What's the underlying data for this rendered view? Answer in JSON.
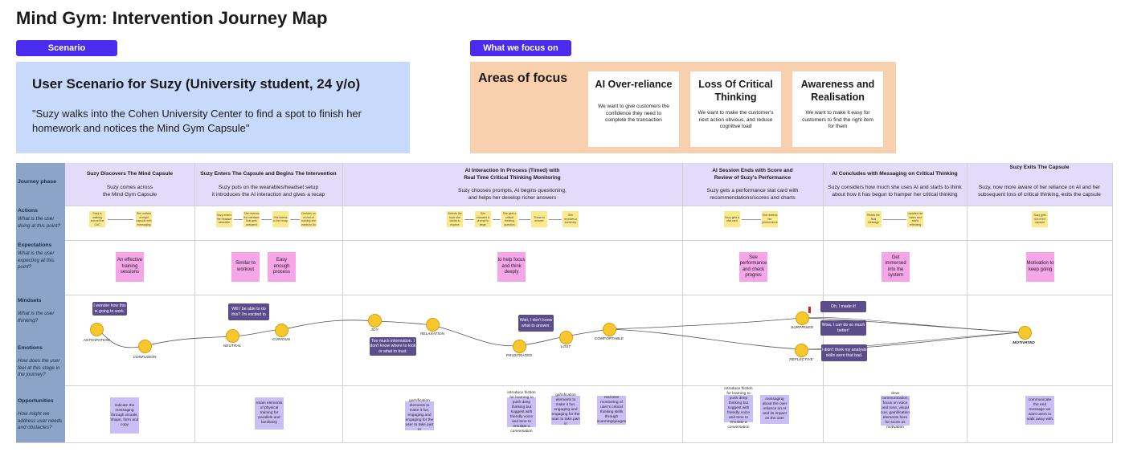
{
  "page_title": "Mind Gym: Intervention Journey Map",
  "scenario": {
    "tag": "Scenario",
    "title": "User Scenario for Suzy (University student, 24 y/o)",
    "quote": "\"Suzy walks into the Cohen University Center to find a spot to finish her homework and notices the Mind Gym Capsule\""
  },
  "focus": {
    "tag": "What we focus on",
    "heading": "Areas of focus",
    "cards": [
      {
        "title": "AI Over-reliance",
        "desc": "We want to give customers the confidence they need to complete the transaction"
      },
      {
        "title": "Loss Of Critical Thinking",
        "desc": "We want to make the customer's next action obvious, and reduce cognitive load"
      },
      {
        "title": "Awareness and Realisation",
        "desc": "We want to make it easy for customers to find the right item for them"
      }
    ]
  },
  "rows": {
    "journey": "Journey phase",
    "actions": "Actions",
    "actions_sub": "What is the user doing at this point?",
    "expectations": "Expectations",
    "expectations_sub": "What is the user expecting at this point?",
    "mindsets": "Mindsets",
    "mindsets_sub": "What is the user thinking?",
    "emotions": "Emotions",
    "emotions_sub": "How does the user feel at this stage in the journey?",
    "opportunities": "Opportunities",
    "opportunities_sub": "How might we address user needs and obstacles?"
  },
  "phases": [
    {
      "title": "Suzy Discovers The Mind Capsule",
      "desc": "Suzy comes across\nthe Mind Gym Capsule"
    },
    {
      "title": "Suzy Enters The Capsule and Begins The Intervention",
      "desc": "Suzy puts on the wearables/headset setup\nit introduces the AI interaction and gives a recap"
    },
    {
      "title": "AI Interaction In Process (Timed) with\nReal Time Critical Thinking Monitoring",
      "desc": "Suzy chooses prompts, AI begins questioning,\nand helps her develop richer answers"
    },
    {
      "title": "AI Session Ends with Score and\nReview of Suzy's Performance",
      "desc": "Suzy gets a performance stat card with\nrecommendations/scores and charts"
    },
    {
      "title": "AI Concludes with Messaging on Critical Thinking",
      "desc": "Suzy considers how much she uses AI and starts to think\nabout how it has begun to hamper her critical thinking"
    },
    {
      "title": "Suzy Exits The Capsule",
      "desc": "Suzy, now more aware of her reliance on AI and her\nsubsequent loss of critical thinking, exits the capsule"
    }
  ],
  "actions": [
    "Suzy is walking around the CUC",
    "She notices a bright capsule with messaging",
    "Suzy enters the headset wearable",
    "She reviews the interface that gets activated",
    "She listens to the recap",
    "Decides on a kind of training she wants to do",
    "Selects the topic she wants to explore",
    "She chooses a prompt to begin",
    "She gets a critical thinking question",
    "Those to answer",
    "She receives a summary",
    "Suzy gets a stat card",
    "She reviews her performance",
    "Reads the final message",
    "Updates her notes and starts reflecting",
    "Suzy gets out of the capsule"
  ],
  "expectations": [
    "An effective training sessions",
    "Similar to workout",
    "Easy enough process",
    "to help focus and think deeply",
    "See performance and check progres",
    "Get immersed into the system",
    "Motivation to keep going"
  ],
  "mindsets": [
    "I wonder how this is going to work.",
    "Will I be able to do this? I'm excited to",
    "Too much information. I don't know where to look or what to trust.",
    "Wait, I don't know what to answer.",
    "Oh, I made it!",
    "Wow, I can do so much better!",
    "I didn't think my analysis skills were that bad."
  ],
  "emotions": [
    "ANTICIPATION",
    "CONFUSION",
    "NEUTRAL",
    "CURIOUS",
    "JOY",
    "RELAXATION",
    "FRUSTRATED",
    "LOST",
    "COMFORTABLE",
    "SURPRISED",
    "REFLECTIVE",
    "MOTIVATED"
  ],
  "opportunities": [
    "indicate the messaging through visuals, shape, form and copy",
    "retain elements of physical training for parallels and familiarity",
    "gamification elements to make it fun, engaging and engaging for the user to take part in",
    "introduce friction for learning to push deep thinking but suggest with friendly voice and tone to emulate a conversation",
    "gamification elements to make it fun, engaging and engaging for the user to take part in",
    "real time monitoring of user's critical thinking skills through scanning/gauges",
    "introduce friction for learning to push deep thinking but suggest with friendly voice and tone to emulate a conversation",
    "messaging about the over reliance on AI and its impact on the user",
    "clear communication, focus on voice and tone, visual cue, gamification elements here for score as motivation",
    "communicate the end message we want users to walk away with"
  ],
  "colors": {
    "tag_bg": "#4a2bf0",
    "scenario_bg": "#c7dafb",
    "focus_bg": "#f9d0ae",
    "label_col": "#8ba4c8",
    "phase_band": "#e2dcfa",
    "sticky_yellow": "#fbe98a",
    "sticky_pink": "#f5a5e8",
    "sticky_purple": "#c9bef5",
    "bubble": "#5b4d8c"
  }
}
